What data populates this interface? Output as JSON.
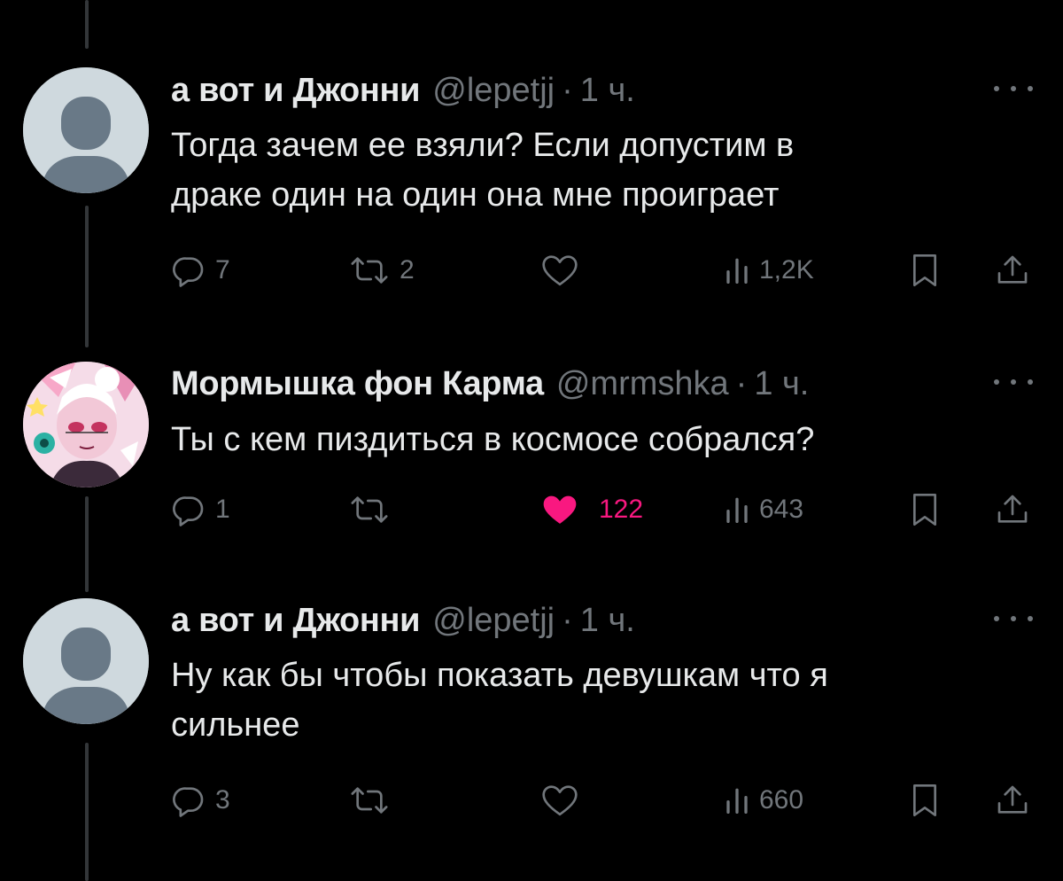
{
  "colors": {
    "background": "#000000",
    "text": "#e7e9ea",
    "muted": "#71767b",
    "like_active": "#f91880",
    "thread_line": "#333639"
  },
  "tweets": [
    {
      "name": "а вот и Джонни",
      "handle": "@lepetjj",
      "separator": "·",
      "time": "1 ч.",
      "lines": [
        "Тогда зачем ее взяли? Если допустим в",
        "драке один на один она мне проиграет"
      ],
      "avatar": "default-avatar-icon",
      "replies": "7",
      "reposts": "2",
      "likes": "",
      "liked": false,
      "views": "1,2K"
    },
    {
      "name": "Мормышка фон Карма",
      "handle": "@mrmshka",
      "separator": "·",
      "time": "1 ч.",
      "lines": [
        "Ты с кем пиздиться в космосе собрался?"
      ],
      "avatar": "anime-character-avatar",
      "replies": "1",
      "reposts": "",
      "likes": "122",
      "liked": true,
      "views": "643"
    },
    {
      "name": "а вот и Джонни",
      "handle": "@lepetjj",
      "separator": "·",
      "time": "1 ч.",
      "lines": [
        "Ну как бы чтобы показать девушкам что я",
        "сильнее"
      ],
      "avatar": "default-avatar-icon",
      "replies": "3",
      "reposts": "",
      "likes": "",
      "liked": false,
      "views": "660"
    }
  ]
}
